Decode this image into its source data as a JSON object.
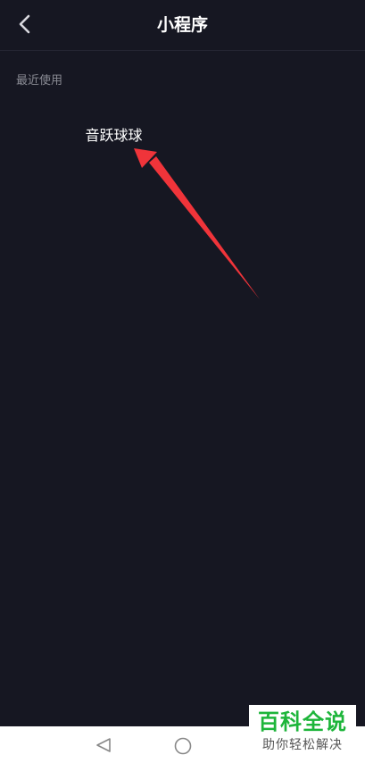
{
  "header": {
    "title": "小程序",
    "back_icon": "chevron-left-icon"
  },
  "recent": {
    "label": "最近使用",
    "items": [
      {
        "name": "音跃球球"
      }
    ]
  },
  "annotation": {
    "color": "#f0343a"
  },
  "system_nav": {
    "back_icon": "triangle-back-icon",
    "home_icon": "circle-home-icon",
    "recent_icon": "square-recent-icon"
  },
  "watermark": {
    "title": "百科全说",
    "subtitle": "助你轻松解决",
    "color": "#1db53a"
  }
}
